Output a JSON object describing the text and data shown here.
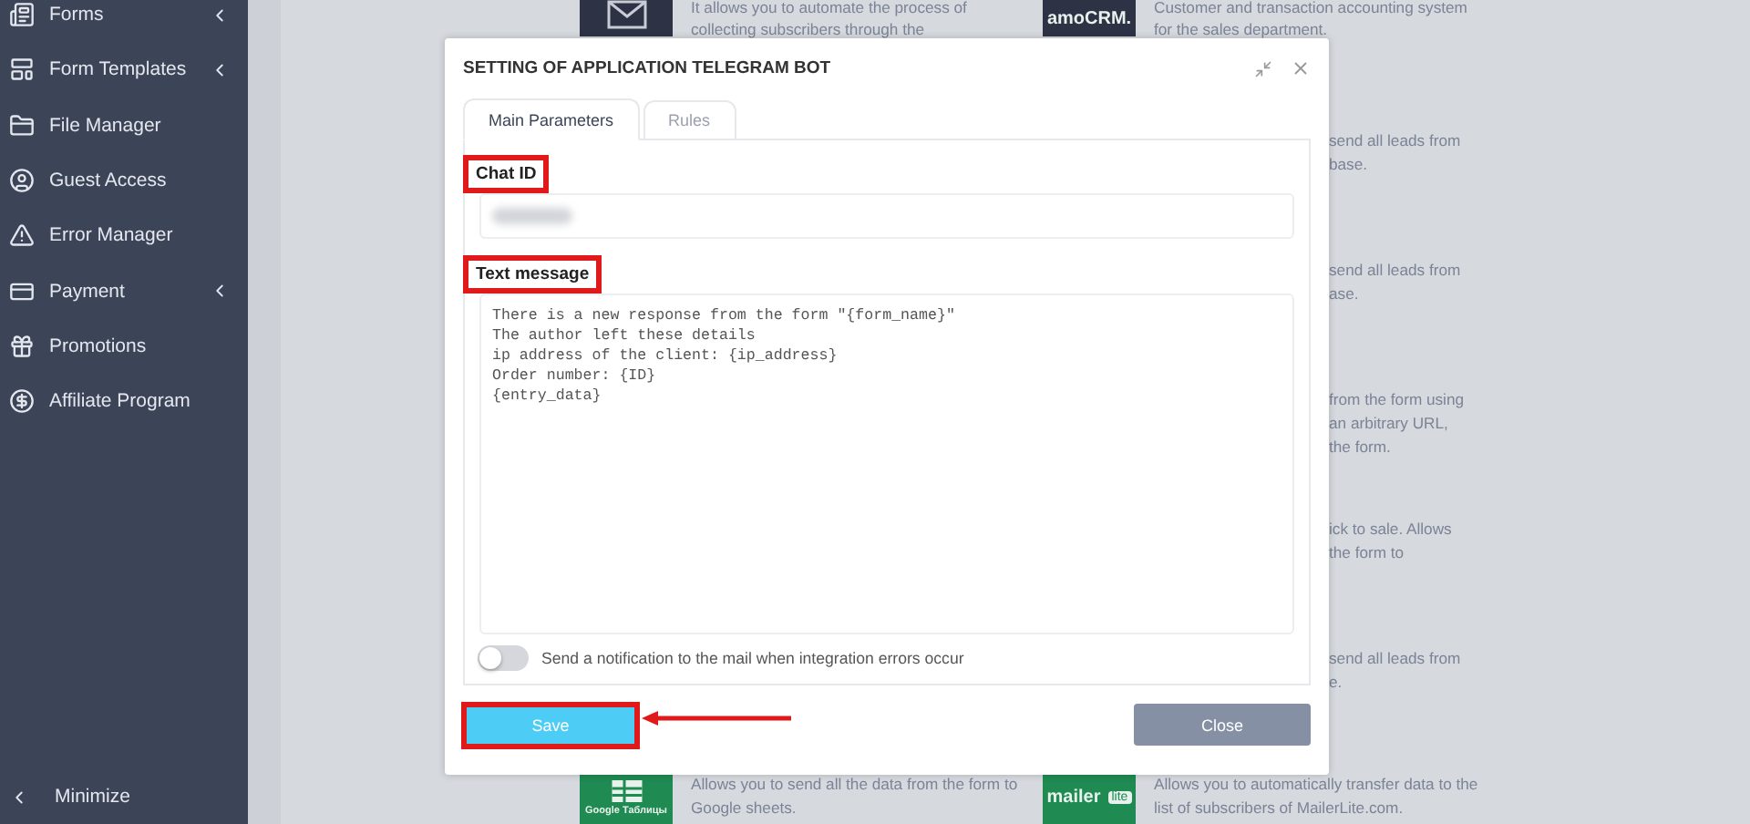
{
  "sidebar": {
    "items": [
      {
        "kind": "forms",
        "label": "Forms",
        "has_submenu": true
      },
      {
        "kind": "templates",
        "label": "Form Templates",
        "has_submenu": true
      },
      {
        "kind": "files",
        "label": "File Manager",
        "has_submenu": false
      },
      {
        "kind": "guest",
        "label": "Guest Access",
        "has_submenu": false
      },
      {
        "kind": "error",
        "label": "Error Manager",
        "has_submenu": false
      },
      {
        "kind": "payment",
        "label": "Payment",
        "has_submenu": true
      },
      {
        "kind": "promo",
        "label": "Promotions",
        "has_submenu": false
      },
      {
        "kind": "affiliate",
        "label": "Affiliate Program",
        "has_submenu": false
      }
    ],
    "minimize": {
      "label": "Minimize"
    }
  },
  "integrations": [
    {
      "kind": "full",
      "left": {
        "kind": "envelope",
        "lines": [
          "It allows you to automate the process of",
          "collecting subscribers through the"
        ]
      },
      "right": {
        "kind": "amocrm",
        "logo_text": "amoCRM.",
        "lines": [
          "Customer and transaction accounting system",
          "for the sales department."
        ]
      }
    },
    {
      "kind": "covered",
      "lines": [
        "send all leads from",
        "base."
      ]
    },
    {
      "kind": "covered",
      "lines": [
        "send all leads from",
        "ase."
      ]
    },
    {
      "kind": "covered",
      "lines": [
        "from the form using",
        "an arbitrary URL,",
        "the form."
      ]
    },
    {
      "kind": "covered",
      "lines": [
        "ick to sale. Allows",
        "the form to"
      ]
    },
    {
      "kind": "covered",
      "lines": [
        "send all leads from",
        "e."
      ]
    },
    {
      "kind": "full",
      "left": {
        "kind": "sheets",
        "logo_text": "Google Таблицы",
        "lines": [
          "Allows you to send all the data from the form to",
          "Google sheets."
        ]
      },
      "right": {
        "kind": "mailerlite",
        "logo_text": "mailer",
        "logo_badge": "lite",
        "lines": [
          "Allows you to automatically transfer data to the",
          "list of subscribers of MailerLite.com."
        ]
      }
    }
  ],
  "modal": {
    "title": "SETTING OF APPLICATION TELEGRAM BOT",
    "tabs": [
      {
        "label": "Main Parameters",
        "selected": true
      },
      {
        "label": "Rules",
        "selected": false
      }
    ],
    "chat_id": {
      "label": "Chat ID",
      "highlighted": true,
      "value_hidden": true
    },
    "text_message": {
      "label": "Text message",
      "highlighted": true,
      "value": "There is a new response from the form \"{form_name}\"\nThe author left these details\nip address of the client: {ip_address}\nOrder number: {ID}\n{entry_data}"
    },
    "notify_toggle": {
      "on": false,
      "label": "Send a notification to the mail when integration errors occur"
    },
    "save": {
      "label": "Save",
      "highlighted": true,
      "arrow": true
    },
    "close": {
      "label": "Close"
    }
  }
}
